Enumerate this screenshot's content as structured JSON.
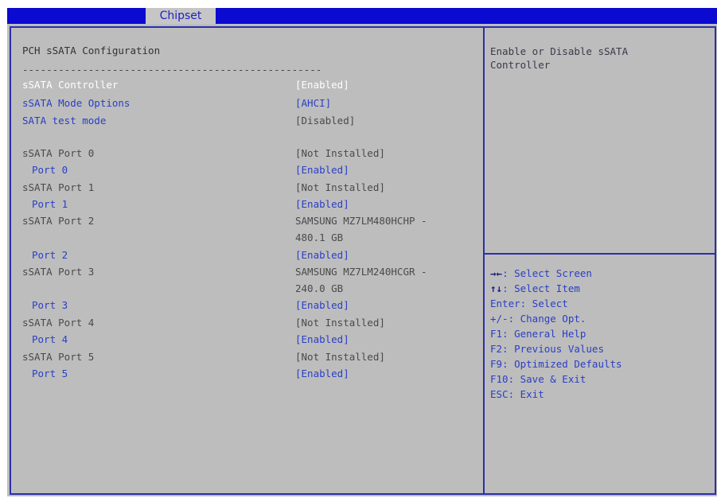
{
  "tab": "Chipset",
  "page_title": "PCH sSATA Configuration",
  "separator": "--------------------------------------------------",
  "settings": [
    {
      "label": "sSATA Controller",
      "value": "[Enabled]",
      "selected": true
    },
    {
      "label": "sSATA Mode Options",
      "value": "[AHCI]"
    },
    {
      "label": "SATA test mode",
      "value": "[Disabled]"
    }
  ],
  "ports": [
    {
      "label": "sSATA Port 0",
      "value": "[Not Installed]",
      "sub_label": "Port 0",
      "sub_value": "[Enabled]"
    },
    {
      "label": "sSATA Port 1",
      "value": "[Not Installed]",
      "sub_label": "Port 1",
      "sub_value": "[Enabled]"
    },
    {
      "label": "sSATA Port 2",
      "value": "SAMSUNG MZ7LM480HCHP -",
      "value2": "480.1 GB",
      "sub_label": "Port 2",
      "sub_value": "[Enabled]"
    },
    {
      "label": "sSATA Port 3",
      "value": "SAMSUNG MZ7LM240HCGR -",
      "value2": "240.0 GB",
      "sub_label": "Port 3",
      "sub_value": "[Enabled]"
    },
    {
      "label": "sSATA Port 4",
      "value": "[Not Installed]",
      "sub_label": "Port 4",
      "sub_value": "[Enabled]"
    },
    {
      "label": "sSATA Port 5",
      "value": "[Not Installed]",
      "sub_label": "Port 5",
      "sub_value": "[Enabled]"
    }
  ],
  "help": {
    "line1": "Enable or Disable sSATA",
    "line2": "Controller"
  },
  "keys": [
    {
      "keys": "→←",
      "desc": ": Select Screen"
    },
    {
      "keys": "↑↓",
      "desc": ": Select Item"
    },
    {
      "keys": "",
      "desc": "Enter: Select"
    },
    {
      "keys": "",
      "desc": "+/-: Change Opt."
    },
    {
      "keys": "",
      "desc": "F1: General Help"
    },
    {
      "keys": "",
      "desc": "F2: Previous Values"
    },
    {
      "keys": "",
      "desc": "F9: Optimized Defaults"
    },
    {
      "keys": "",
      "desc": "F10: Save & Exit"
    },
    {
      "keys": "",
      "desc": "ESC: Exit"
    }
  ],
  "colors": {
    "top_bar": "#0a0ad0",
    "panel_bg": "#bdbdbd",
    "border": "#2b2fa8",
    "selected_text": "#ffffff",
    "option_text": "#2a3fc4"
  }
}
